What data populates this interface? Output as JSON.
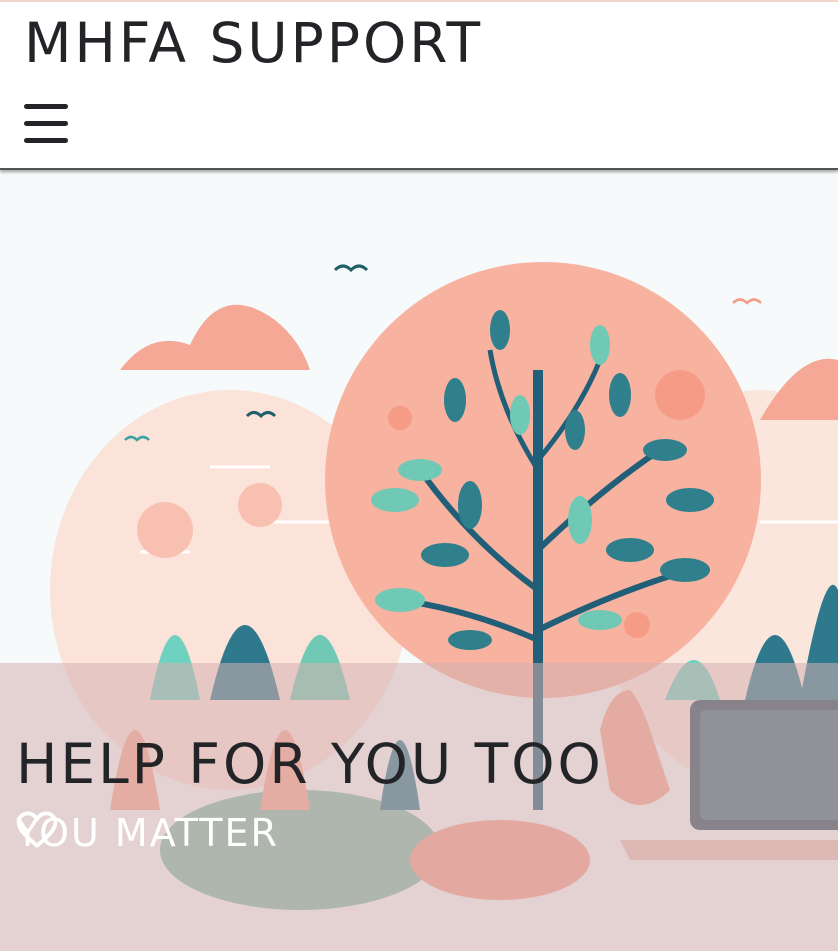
{
  "header": {
    "brand": "MHFA SUPPORT",
    "menu_icon": "hamburger-menu-icon"
  },
  "hero": {
    "title": "HELP FOR YOU TOO",
    "subtitle": "YOU MATTER",
    "subtitle_icon": "heart-outline-icon",
    "illustration": "tree-and-laptop-illustration"
  },
  "colors": {
    "text": "#222428",
    "peach": "#f5a896",
    "teal": "#2f7f8c",
    "mint": "#6fc9b5",
    "overlay": "#d6b0b0"
  }
}
